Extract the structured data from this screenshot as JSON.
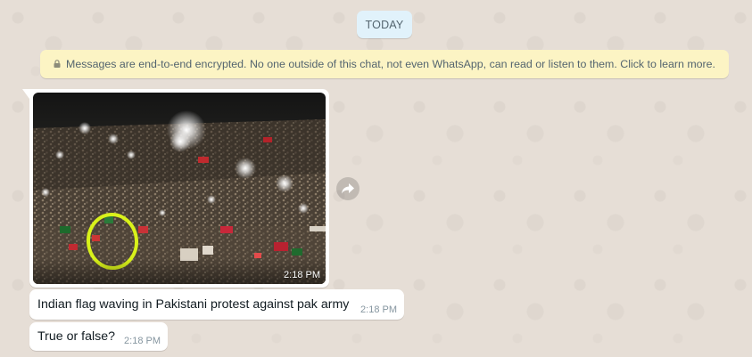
{
  "date_chip": {
    "label": "TODAY"
  },
  "encryption_notice": {
    "icon": "lock-icon",
    "text": "Messages are end-to-end encrypted. No one outside of this chat, not even WhatsApp, can read or listen to them. Click to learn more."
  },
  "messages": [
    {
      "type": "image",
      "time": "2:18 PM",
      "icon_forward": "forward-icon"
    },
    {
      "type": "text",
      "text": "Indian flag waving in Pakistani protest against pak army",
      "time": "2:18 PM"
    },
    {
      "type": "text",
      "text": "True or false?",
      "time": "2:18 PM"
    }
  ],
  "colors": {
    "wallpaper": "#e6ded6",
    "date_chip_bg": "#e1f2fb",
    "notice_bg": "#fcf4c4",
    "bubble_bg": "#ffffff",
    "highlight_circle": "#d9f21a"
  }
}
